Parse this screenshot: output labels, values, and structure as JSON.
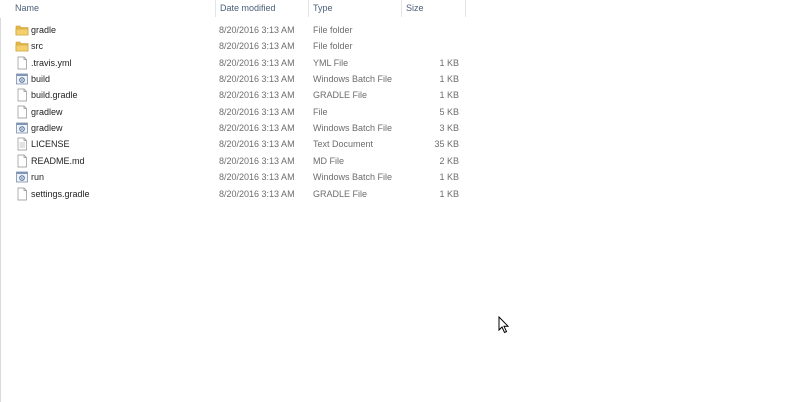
{
  "columns": {
    "name": "Name",
    "date_modified": "Date modified",
    "type": "Type",
    "size": "Size"
  },
  "files": [
    {
      "name": "gradle",
      "date": "8/20/2016 3:13 AM",
      "type": "File folder",
      "size": "",
      "icon": "folder-icon"
    },
    {
      "name": "src",
      "date": "8/20/2016 3:13 AM",
      "type": "File folder",
      "size": "",
      "icon": "folder-icon"
    },
    {
      "name": ".travis.yml",
      "date": "8/20/2016 3:13 AM",
      "type": "YML File",
      "size": "1 KB",
      "icon": "file-icon"
    },
    {
      "name": "build",
      "date": "8/20/2016 3:13 AM",
      "type": "Windows Batch File",
      "size": "1 KB",
      "icon": "batch-file-icon"
    },
    {
      "name": "build.gradle",
      "date": "8/20/2016 3:13 AM",
      "type": "GRADLE File",
      "size": "1 KB",
      "icon": "file-icon"
    },
    {
      "name": "gradlew",
      "date": "8/20/2016 3:13 AM",
      "type": "File",
      "size": "5 KB",
      "icon": "file-icon"
    },
    {
      "name": "gradlew",
      "date": "8/20/2016 3:13 AM",
      "type": "Windows Batch File",
      "size": "3 KB",
      "icon": "batch-file-icon"
    },
    {
      "name": "LICENSE",
      "date": "8/20/2016 3:13 AM",
      "type": "Text Document",
      "size": "35 KB",
      "icon": "text-file-icon"
    },
    {
      "name": "README.md",
      "date": "8/20/2016 3:13 AM",
      "type": "MD File",
      "size": "2 KB",
      "icon": "file-icon"
    },
    {
      "name": "run",
      "date": "8/20/2016 3:13 AM",
      "type": "Windows Batch File",
      "size": "1 KB",
      "icon": "batch-file-icon"
    },
    {
      "name": "settings.gradle",
      "date": "8/20/2016 3:13 AM",
      "type": "GRADLE File",
      "size": "1 KB",
      "icon": "file-icon"
    }
  ],
  "colors": {
    "header_text": "#4c607a",
    "secondary_text": "#6d6d6d",
    "folder": "#e8b84a"
  }
}
